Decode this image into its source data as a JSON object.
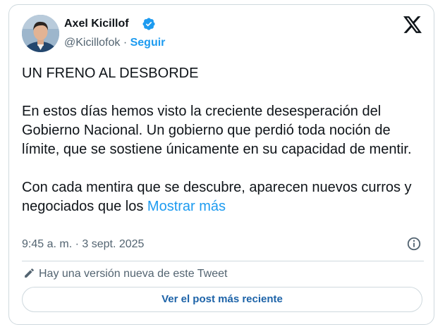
{
  "author": {
    "name": "Axel Kicillof",
    "handle": "@Kicillofok",
    "separator": "·",
    "follow_label": "Seguir"
  },
  "tweet": {
    "headline": "UN FRENO AL DESBORDE",
    "paragraph1": "En estos días hemos visto la creciente desesperación del Gobierno Nacional. Un gobierno que perdió toda noción de límite, que se sostiene únicamente en su capacidad de mentir.",
    "paragraph2": "Con cada mentira que se descubre, aparecen nuevos curros y negociados que los",
    "show_more_label": "Mostrar más",
    "timestamp": "9:45 a. m. · 3 sept. 2025"
  },
  "edit_notice": {
    "text": "Hay una versión nueva de este Tweet",
    "button_label": "Ver el post más reciente"
  },
  "colors": {
    "accent": "#1d9bf0",
    "text": "#0f1419",
    "secondary": "#536471",
    "border": "#cfd9de"
  },
  "icons": {
    "verified": "verified-badge-icon",
    "logo": "x-logo-icon",
    "info": "info-icon",
    "edit": "pencil-icon"
  }
}
